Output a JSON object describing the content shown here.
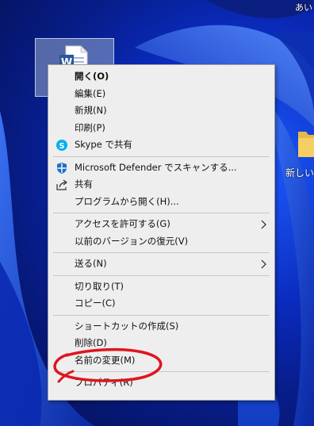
{
  "corner_text": "あい",
  "desktop_folder": {
    "label": "新しいフ"
  },
  "context_menu": {
    "items": [
      {
        "id": "open",
        "label": "開く(O)",
        "bold": true
      },
      {
        "id": "edit",
        "label": "編集(E)"
      },
      {
        "id": "new",
        "label": "新規(N)"
      },
      {
        "id": "print",
        "label": "印刷(P)"
      },
      {
        "id": "skype-share",
        "label": "Skype で共有",
        "icon": "skype-icon"
      },
      {
        "id": "defender-scan",
        "label": "Microsoft Defender でスキャンする...",
        "icon": "defender-shield-icon"
      },
      {
        "id": "share",
        "label": "共有",
        "icon": "share-icon"
      },
      {
        "id": "open-with",
        "label": "プログラムから開く(H)..."
      },
      {
        "id": "give-access",
        "label": "アクセスを許可する(G)",
        "submenu": true
      },
      {
        "id": "restore-versions",
        "label": "以前のバージョンの復元(V)"
      },
      {
        "id": "send-to",
        "label": "送る(N)",
        "submenu": true
      },
      {
        "id": "cut",
        "label": "切り取り(T)"
      },
      {
        "id": "copy",
        "label": "コピー(C)"
      },
      {
        "id": "create-shortcut",
        "label": "ショートカットの作成(S)"
      },
      {
        "id": "delete",
        "label": "削除(D)"
      },
      {
        "id": "rename",
        "label": "名前の変更(M)",
        "highlighted_by_annotation": true
      },
      {
        "id": "properties",
        "label": "プロパティ(R)"
      }
    ]
  },
  "colors": {
    "annotation": "#e0141e",
    "menu_background": "#eeeeee",
    "skype": "#00aff0",
    "defender": "#1e6ec8"
  }
}
